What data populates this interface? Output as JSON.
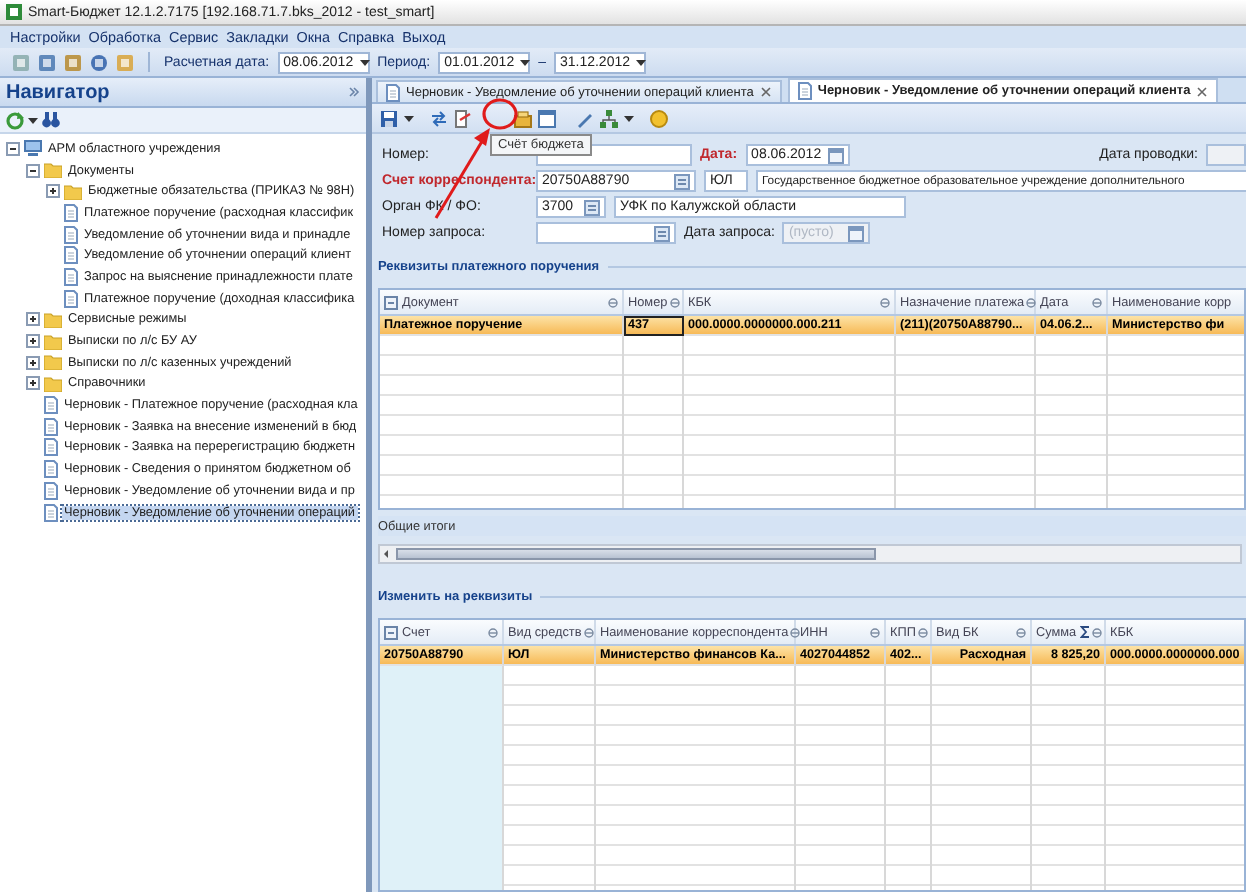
{
  "window": {
    "title": "Smart-Бюджет 12.1.2.7175 [192.168.71.7.bks_2012 - test_smart]"
  },
  "menu": [
    {
      "label": "Настройки"
    },
    {
      "label": "Обработка"
    },
    {
      "label": "Сервис"
    },
    {
      "label": "Закладки"
    },
    {
      "label": "Окна"
    },
    {
      "label": "Справка"
    },
    {
      "label": "Выход"
    }
  ],
  "toolbar": {
    "calc_date_label": "Расчетная дата:",
    "calc_date": "08.06.2012",
    "period_label": "Период:",
    "period_from": "01.01.2012",
    "period_separator": "–",
    "period_to": "31.12.2012"
  },
  "navigator": {
    "title": "Навигатор",
    "tree": [
      {
        "label": "АРМ областного учреждения",
        "kind": "root",
        "expanded": true,
        "selected": false,
        "children": [
          {
            "label": "Документы",
            "kind": "folder",
            "expanded": true,
            "selected": false,
            "children": [
              {
                "label": "Бюджетные обязательства (ПРИКАЗ № 98Н)",
                "kind": "folder",
                "expanded": false,
                "selected": false
              },
              {
                "label": "Платежное поручение (расходная классифик",
                "kind": "doc",
                "selected": false
              },
              {
                "label": "Уведомление об уточнении вида и принадле",
                "kind": "doc",
                "selected": false
              },
              {
                "label": "Уведомление об уточнении операций клиент",
                "kind": "doc",
                "selected": false
              },
              {
                "label": "Запрос на выяснение принадлежности плате",
                "kind": "doc",
                "selected": false
              },
              {
                "label": "Платежное поручение (доходная классифика",
                "kind": "doc",
                "selected": false
              }
            ]
          },
          {
            "label": "Сервисные режимы",
            "kind": "folder",
            "expanded": false,
            "selected": false
          },
          {
            "label": "Выписки по л/с БУ АУ",
            "kind": "folder",
            "expanded": false,
            "selected": false
          },
          {
            "label": "Выписки по л/с казенных учреждений",
            "kind": "folder",
            "expanded": false,
            "selected": false
          },
          {
            "label": "Справочники",
            "kind": "folder",
            "expanded": false,
            "selected": false
          },
          {
            "label": "Черновик - Платежное поручение (расходная кла",
            "kind": "doc",
            "selected": false
          },
          {
            "label": "Черновик - Заявка на внесение изменений в бюд",
            "kind": "doc",
            "selected": false
          },
          {
            "label": "Черновик - Заявка на перерегистрацию бюджетн",
            "kind": "doc",
            "selected": false
          },
          {
            "label": "Черновик - Сведения о принятом бюджетном об",
            "kind": "doc",
            "selected": false
          },
          {
            "label": "Черновик - Уведомление об уточнении вида и пр",
            "kind": "doc",
            "selected": false
          },
          {
            "label": "Черновик - Уведомление об уточнении операций",
            "kind": "doc",
            "selected": true
          }
        ]
      }
    ]
  },
  "document": {
    "tabs": [
      {
        "label": "Черновик - Уведомление об уточнении операций клиента",
        "selected": false
      },
      {
        "label": "Черновик - Уведомление об уточнении операций клиента",
        "selected": true
      }
    ],
    "tooltip": "Счёт бюджета",
    "annotations": {
      "highlight_circle": true,
      "pointer_arrow": true
    },
    "form": {
      "number": {
        "label": "Номер:",
        "required": false
      },
      "date": {
        "label": "Дата:",
        "required": true,
        "value": "08.06.2012"
      },
      "posting_date": {
        "label": "Дата проводки:",
        "required": false
      },
      "correspondent": {
        "label": "Счет корреспондента:",
        "required": true,
        "account": "20750А88790",
        "type": "ЮЛ",
        "name": "Государственное бюджетное образовательное учреждение дополнительного"
      },
      "fk_body": {
        "label": "Орган ФК / ФО:",
        "required": false,
        "code": "3700",
        "name": "УФК по Калужской области"
      },
      "request_number": {
        "label": "Номер запроса:",
        "required": false
      },
      "request_date": {
        "label": "Дата запроса:",
        "required": false,
        "placeholder": "(пусто)"
      }
    },
    "payment_details": {
      "title": "Реквизиты платежного поручения",
      "totals_label": "Общие итоги",
      "columns": [
        {
          "label": "Документ"
        },
        {
          "label": "Номер"
        },
        {
          "label": "КБК"
        },
        {
          "label": "Назначение платежа"
        },
        {
          "label": "Дата"
        },
        {
          "label": "Наименование корр"
        }
      ],
      "rows": [
        {
          "selected": true,
          "cells": [
            "Платежное поручение",
            "437",
            "000.0000.0000000.000.211",
            "(211)(20750А88790...",
            "04.06.2...",
            "Министерство фи"
          ]
        }
      ]
    },
    "change_details": {
      "title": "Изменить на реквизиты",
      "columns": [
        {
          "label": "Счет",
          "summed": false
        },
        {
          "label": "Вид средств",
          "summed": false
        },
        {
          "label": "Наименование корреспондента",
          "summed": false
        },
        {
          "label": "ИНН",
          "summed": false
        },
        {
          "label": "КПП",
          "summed": false
        },
        {
          "label": "Вид БК",
          "summed": false
        },
        {
          "label": "Сумма",
          "summed": true
        },
        {
          "label": "КБК",
          "summed": false
        }
      ],
      "rows": [
        {
          "selected": true,
          "cells": [
            "20750А88790",
            "ЮЛ",
            "Министерство финансов Ка...",
            "4027044852",
            "402...",
            "Расходная",
            "8 825,20",
            "000.0000.0000000.000"
          ]
        }
      ]
    }
  }
}
